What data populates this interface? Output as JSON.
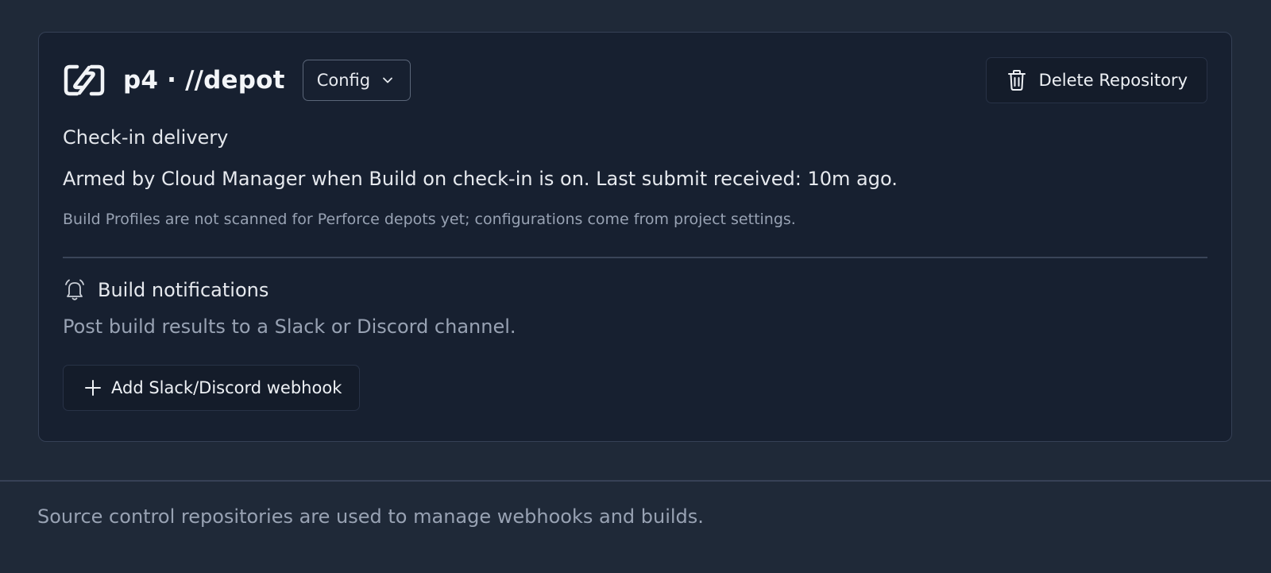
{
  "repository": {
    "title": "p4 · //depot",
    "logo_icon": "perforce-logo-icon",
    "config_label": "Config",
    "config_icon": "chevron-down-icon",
    "delete_label": "Delete Repository",
    "delete_icon": "trash-icon"
  },
  "delivery": {
    "section_label": "Check-in delivery",
    "status": "Armed by Cloud Manager when Build on check-in is on. Last submit received: 10m ago.",
    "note": "Build Profiles are not scanned for Perforce depots yet; configurations come from project settings."
  },
  "notifications": {
    "icon": "bell-icon",
    "title": "Build notifications",
    "description": "Post build results to a Slack or Discord channel.",
    "add_webhook_label": "Add Slack/Discord webhook",
    "add_icon": "plus-icon"
  },
  "footer": {
    "text": "Source control repositories are used to manage webhooks and builds."
  },
  "colors": {
    "page_background": "#1f2938",
    "card_background": "#172030",
    "card_border": "#354055",
    "primary_text": "#e6e9ee",
    "muted_text": "#98a2b3"
  }
}
